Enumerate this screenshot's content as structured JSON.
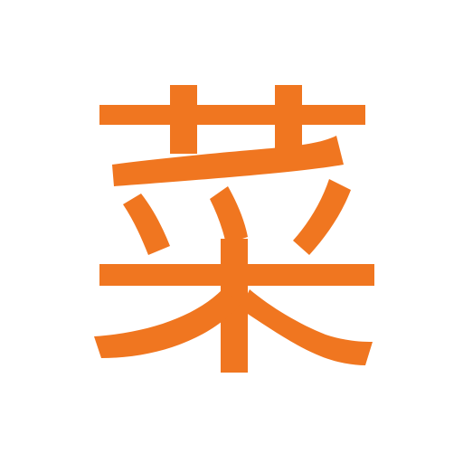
{
  "app_icon": {
    "glyph": "菜",
    "icon_name": "cai-vegetable-glyph-icon",
    "colors": {
      "glyph": "#f07620",
      "background": "#ffffff"
    }
  }
}
